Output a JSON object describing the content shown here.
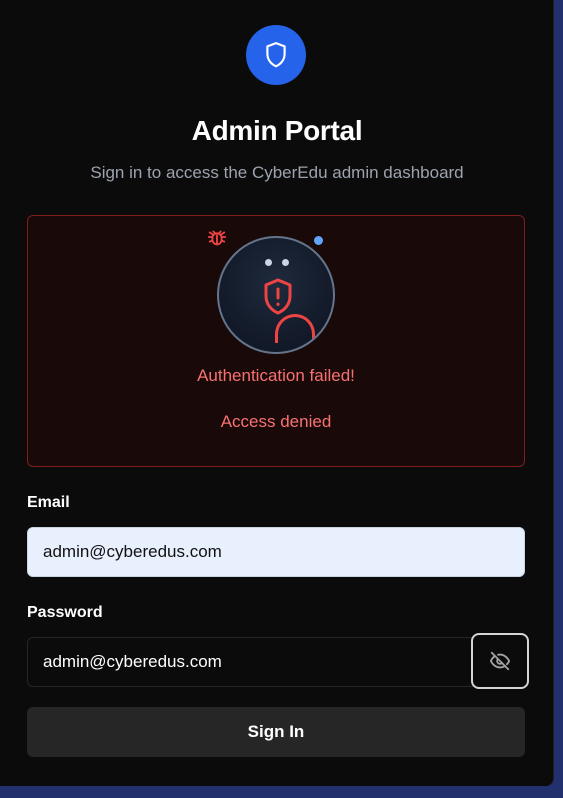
{
  "header": {
    "title": "Admin Portal",
    "subtitle": "Sign in to access the CyberEdu admin dashboard"
  },
  "icons": {
    "logo": "shield-icon",
    "bug": "bug-icon",
    "alert_shield": "shield-alert-icon",
    "password_toggle": "eye-off-icon"
  },
  "alert": {
    "title": "Authentication failed!",
    "message": "Access denied"
  },
  "form": {
    "email_label": "Email",
    "email_value": "admin@cyberedus.com",
    "password_label": "Password",
    "password_value": "admin@cyberedus.com",
    "submit_label": "Sign In"
  },
  "colors": {
    "accent": "#2563eb",
    "error": "#f87171",
    "error_border": "#7f1d1d",
    "background": "#0b0b0b",
    "page_background": "#22306e"
  }
}
